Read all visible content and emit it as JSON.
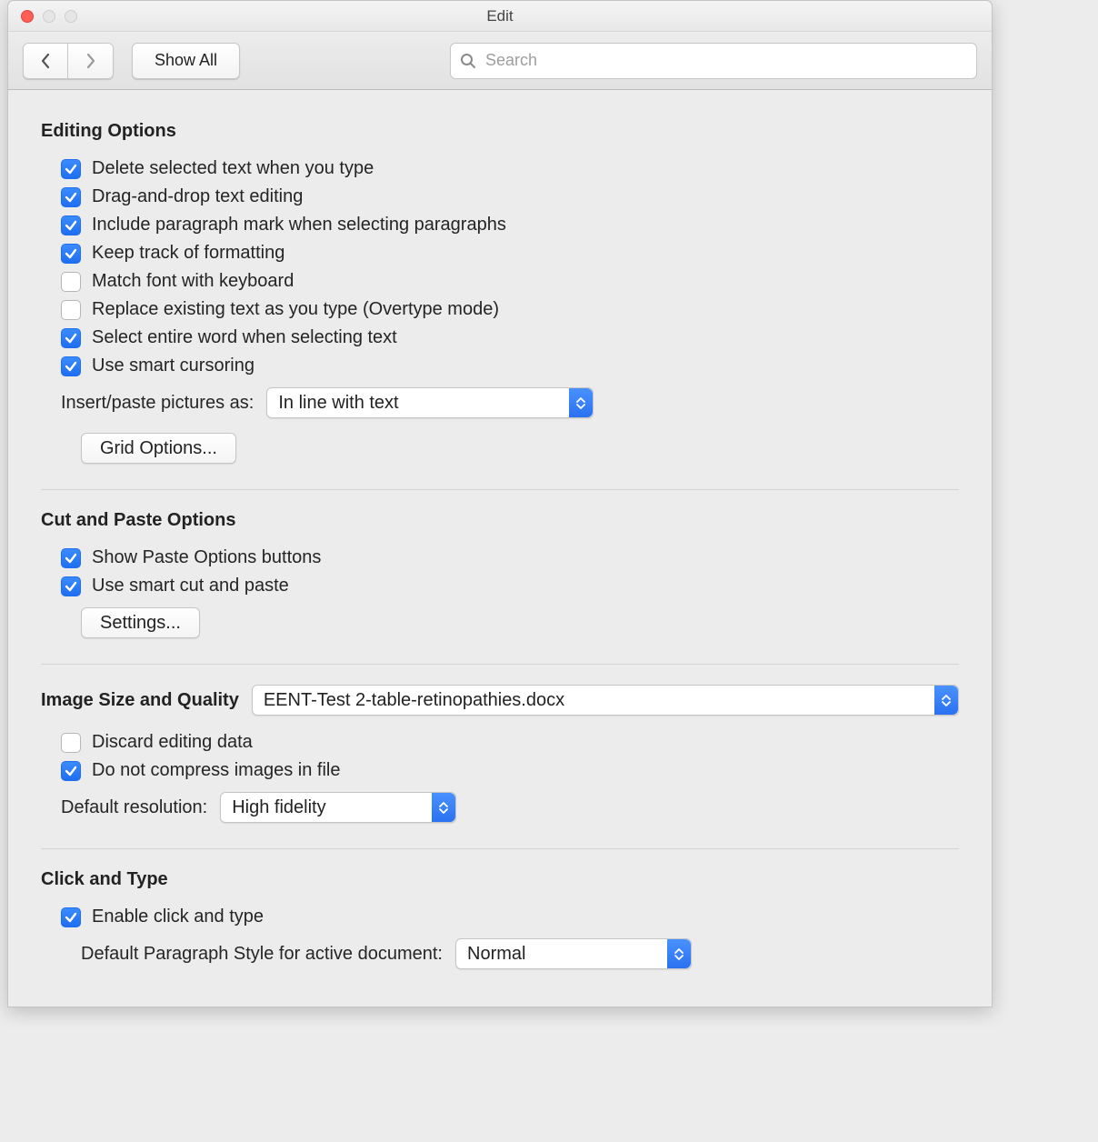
{
  "window": {
    "title": "Edit"
  },
  "toolbar": {
    "show_all_label": "Show All",
    "search_placeholder": "Search"
  },
  "sections": {
    "editing": {
      "title": "Editing Options",
      "items": [
        {
          "label": "Delete selected text when you type",
          "checked": true
        },
        {
          "label": "Drag-and-drop text editing",
          "checked": true
        },
        {
          "label": "Include paragraph mark when selecting paragraphs",
          "checked": true
        },
        {
          "label": "Keep track of formatting",
          "checked": true
        },
        {
          "label": "Match font with keyboard",
          "checked": false
        },
        {
          "label": "Replace existing text as you type (Overtype mode)",
          "checked": false
        },
        {
          "label": "Select entire word when selecting text",
          "checked": true
        },
        {
          "label": "Use smart cursoring",
          "checked": true
        }
      ],
      "insert_pictures_label": "Insert/paste pictures as:",
      "insert_pictures_value": "In line with text",
      "grid_options_label": "Grid Options..."
    },
    "cutpaste": {
      "title": "Cut and Paste Options",
      "items": [
        {
          "label": "Show Paste Options buttons",
          "checked": true
        },
        {
          "label": "Use smart cut and paste",
          "checked": true
        }
      ],
      "settings_label": "Settings..."
    },
    "image": {
      "title": "Image Size and Quality",
      "doc_select_value": "EENT-Test 2-table-retinopathies.docx",
      "items": [
        {
          "label": "Discard editing data",
          "checked": false
        },
        {
          "label": "Do not compress images in file",
          "checked": true
        }
      ],
      "default_resolution_label": "Default resolution:",
      "default_resolution_value": "High fidelity"
    },
    "click": {
      "title": "Click and Type",
      "item": {
        "label": "Enable click and type",
        "checked": true
      },
      "paragraph_style_label": "Default Paragraph Style for active document:",
      "paragraph_style_value": "Normal"
    }
  }
}
